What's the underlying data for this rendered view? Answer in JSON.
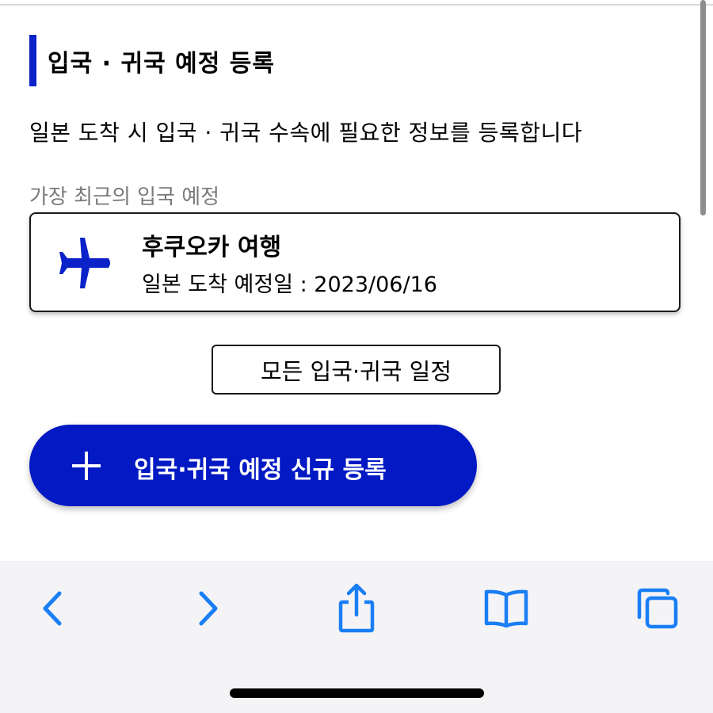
{
  "section": {
    "title": "입국 · 귀국 예정 등록",
    "description": "일본 도착 시 입국 · 귀국 수속에 필요한 정보를 등록합니다"
  },
  "recent": {
    "label": "가장 최근의 입국 예정",
    "trip": {
      "name": "후쿠오카 여행",
      "arrival": "일본 도착 예정일 : 2023/06/16",
      "icon": "airplane-icon"
    }
  },
  "buttons": {
    "all_schedules": "모든 입국·귀국 일정",
    "new_registration": "입국·귀국 예정 신규 등록"
  },
  "toolbar": {
    "items": [
      "back-icon",
      "forward-icon",
      "share-icon",
      "bookmarks-icon",
      "tabs-icon"
    ]
  },
  "colors": {
    "accent": "#0219c3",
    "toolbar_icon": "#1a7ef5",
    "toolbar_bg": "#f4f4f6"
  }
}
